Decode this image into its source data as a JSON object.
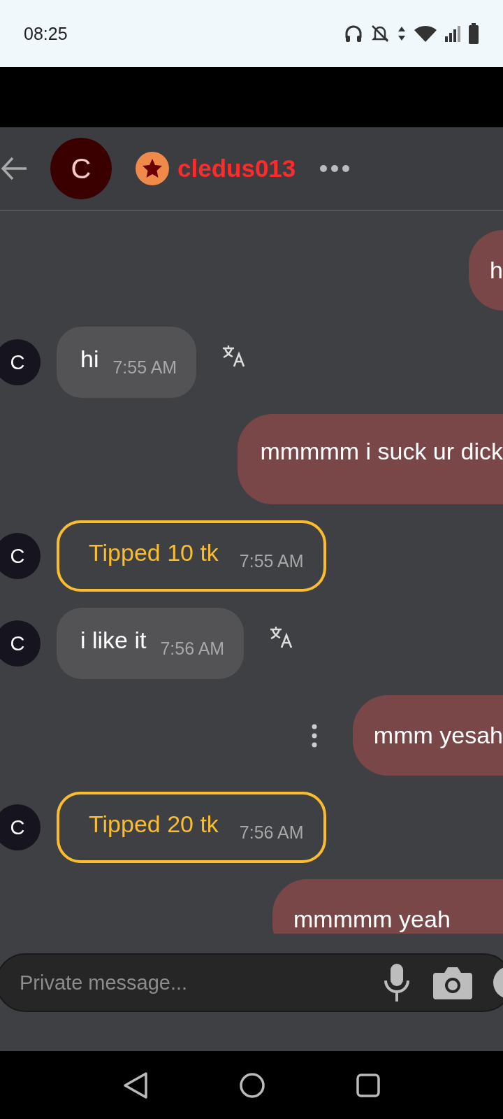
{
  "status_bar": {
    "time": "08:25"
  },
  "header": {
    "avatar_letter": "C",
    "username": "cledus013"
  },
  "messages": [
    {
      "kind": "outgoing",
      "text": "h",
      "menu": false
    },
    {
      "kind": "incoming",
      "avatar_letter": "C",
      "text": "hi",
      "time": "7:55 AM"
    },
    {
      "kind": "outgoing",
      "text": "mmmmm i suck ur dick",
      "menu": false
    },
    {
      "kind": "tip",
      "avatar_letter": "C",
      "text": "Tipped 10 tk",
      "time": "7:55 AM"
    },
    {
      "kind": "incoming",
      "avatar_letter": "C",
      "text": "i like it",
      "time": "7:56 AM"
    },
    {
      "kind": "outgoing",
      "text": "mmm yesah",
      "menu": true
    },
    {
      "kind": "tip",
      "avatar_letter": "C",
      "text": "Tipped 20 tk",
      "time": "7:56 AM"
    },
    {
      "kind": "outgoing",
      "text": "mmmmm yeah",
      "menu": false
    }
  ],
  "composer": {
    "placeholder": "Private message..."
  }
}
